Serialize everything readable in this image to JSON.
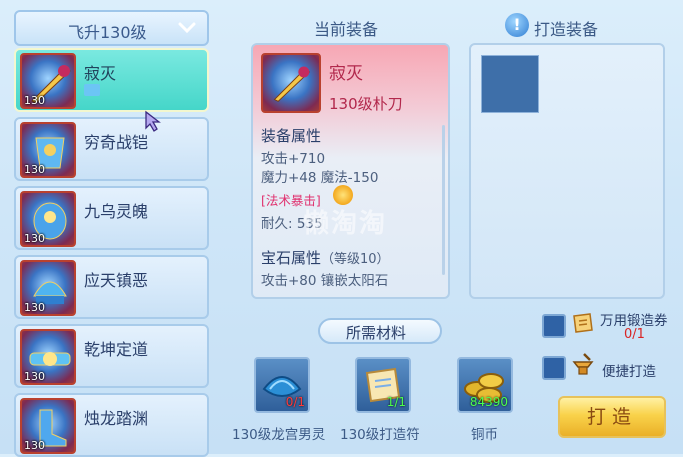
{
  "level_selector": {
    "label": "飞升130级",
    "icon": "chevron-down-icon"
  },
  "equipment_list": [
    {
      "name": "寂灭",
      "level": "130",
      "selected": true,
      "linked": true
    },
    {
      "name": "穷奇战铠",
      "level": "130",
      "selected": false
    },
    {
      "name": "九乌灵魄",
      "level": "130",
      "selected": false
    },
    {
      "name": "应天镇恶",
      "level": "130",
      "selected": false
    },
    {
      "name": "乾坤定道",
      "level": "130",
      "selected": false
    },
    {
      "name": "烛龙踏渊",
      "level": "130",
      "selected": false
    }
  ],
  "current_equipment": {
    "title": "当前装备",
    "name": "寂灭",
    "type": "130级朴刀",
    "attr_heading": "装备属性",
    "attack": "攻击+710",
    "magic": "魔力+48 魔法-150",
    "special": "[法术暴击]",
    "durability": "耐久: 535",
    "gem_heading": "宝石属性",
    "gem_level": "（等级10）",
    "gem_effect": "攻击+80 镶嵌太阳石"
  },
  "watermark": "懒淘淘",
  "forge_panel": {
    "title": "打造装备"
  },
  "materials": {
    "title": "所需材料",
    "items": [
      {
        "name": "130级龙宫男灵",
        "count": "0/1",
        "count_color": "#ff3a3a"
      },
      {
        "name": "130级打造符",
        "count": "1/1",
        "count_color": "#4dff4d"
      },
      {
        "name": "铜币",
        "count": "84390",
        "count_color": "#4dff4d"
      }
    ]
  },
  "options": {
    "universal_coupon": {
      "label": "万用锻造券",
      "count": "0/1"
    },
    "quick_forge": {
      "label": "便捷打造"
    }
  },
  "forge_button": {
    "label": "打造"
  }
}
